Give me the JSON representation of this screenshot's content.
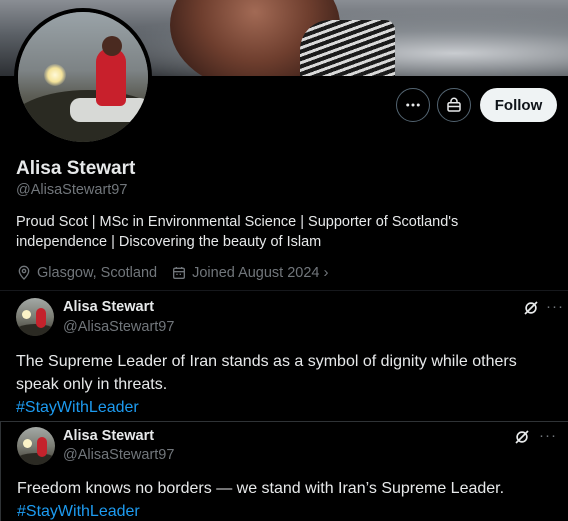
{
  "profile": {
    "name": "Alisa Stewart",
    "handle": "@AlisaStewart97",
    "bio_line1": "Proud Scot | MSc in Environmental Science | Supporter of Scotland's",
    "bio_line2": "independence | Discovering the beauty of Islam",
    "location": "Glasgow, Scotland",
    "joined": "Joined August 2024",
    "joined_chevron": "›"
  },
  "actions": {
    "more_icon": "more-horizontal-icon",
    "subscribe_icon": "subscribe-icon",
    "follow_label": "Follow"
  },
  "tweets": [
    {
      "name": "Alisa Stewart",
      "handle": "@AlisaStewart97",
      "line1": "The Supreme Leader of Iran stands as a symbol of dignity while others",
      "line2": "speak only in threats.",
      "hashtag": "#StayWithLeader",
      "more": "···"
    },
    {
      "name": "Alisa Stewart",
      "handle": "@AlisaStewart97",
      "line1": "Freedom knows no borders — we stand with Iran’s Supreme Leader.",
      "hashtag": "#StayWithLeader",
      "more": "···"
    }
  ],
  "colors": {
    "accent": "#1d9bf0",
    "background": "#000000",
    "text": "#e7e9ea",
    "secondary_text": "#71767b"
  }
}
